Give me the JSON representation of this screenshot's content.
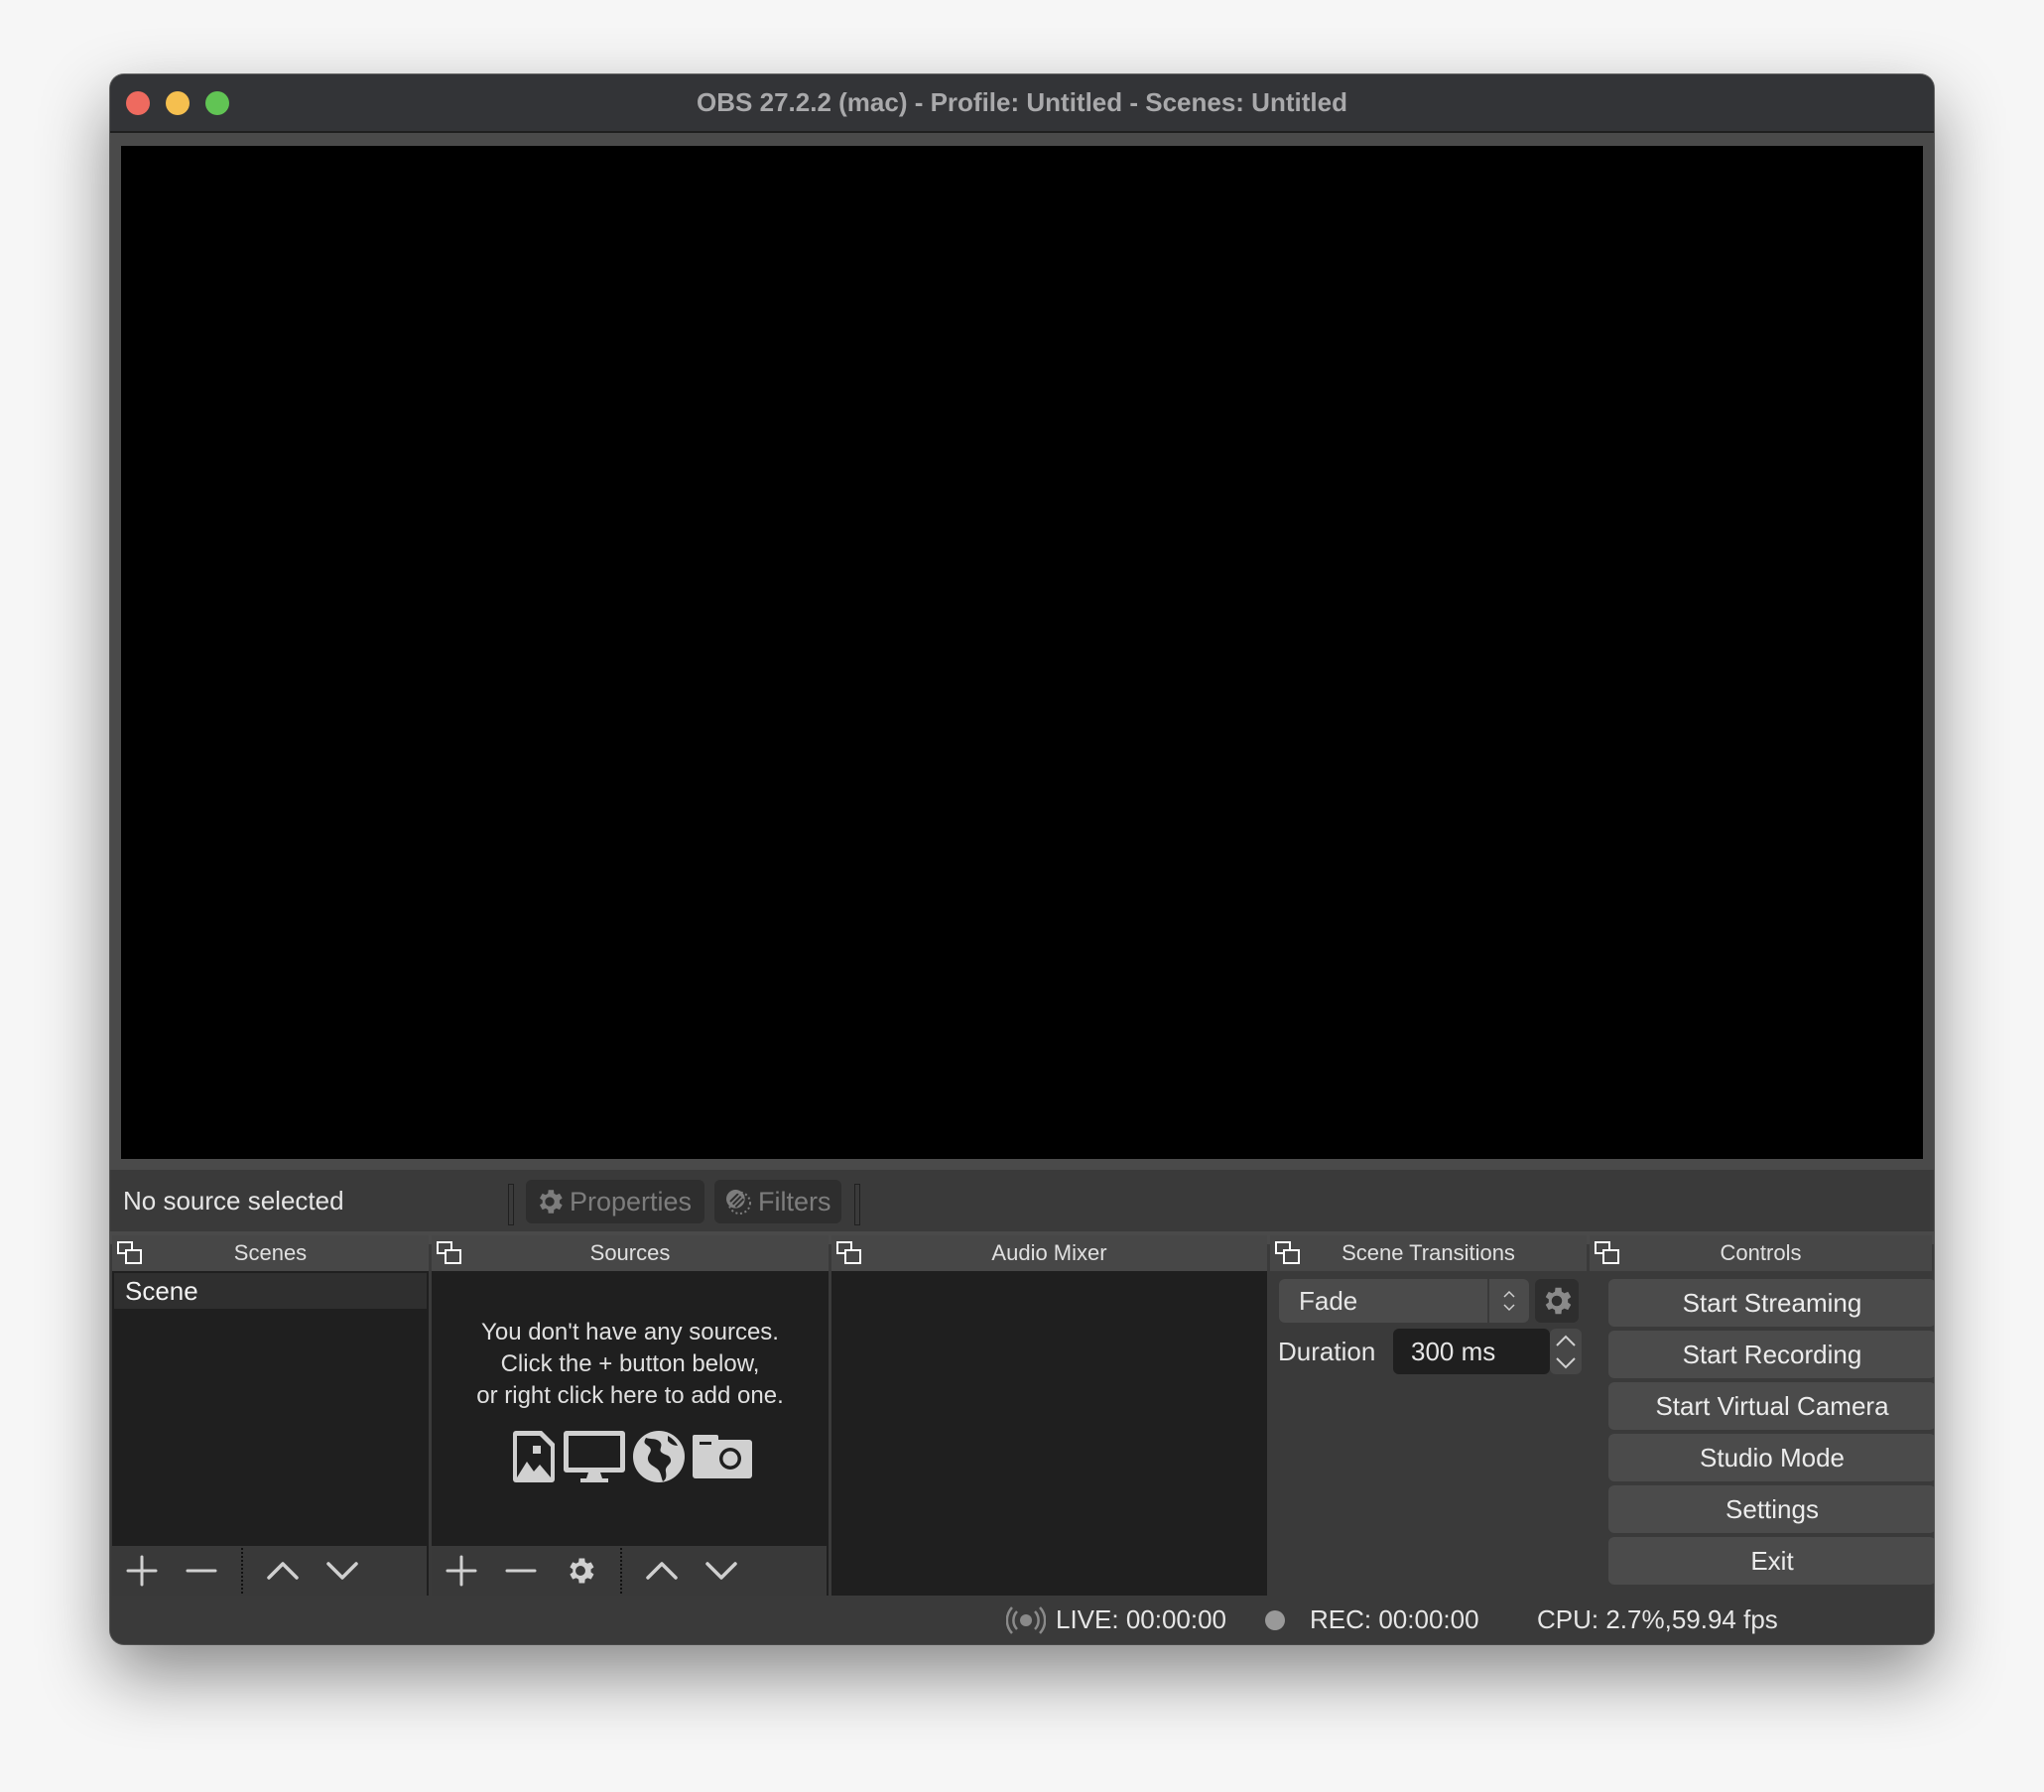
{
  "window": {
    "title": "OBS 27.2.2 (mac) - Profile: Untitled - Scenes: Untitled",
    "traffic_lights": {
      "close": "#ee6a5f",
      "minimize": "#f5bf4f",
      "maximize": "#61c454"
    }
  },
  "context_bar": {
    "selection_label": "No source selected",
    "properties_label": "Properties",
    "filters_label": "Filters"
  },
  "docks": {
    "scenes": {
      "title": "Scenes",
      "items": [
        {
          "label": "Scene",
          "selected": true
        }
      ]
    },
    "sources": {
      "title": "Sources",
      "empty_message": [
        "You don't have any sources.",
        "Click the + button below,",
        "or right click here to add one."
      ],
      "empty_icons": [
        "image-icon",
        "display-icon",
        "globe-icon",
        "camera-icon"
      ]
    },
    "audio_mixer": {
      "title": "Audio Mixer"
    },
    "scene_transitions": {
      "title": "Scene Transitions",
      "transition": "Fade",
      "duration_label": "Duration",
      "duration_value": "300 ms"
    },
    "controls": {
      "title": "Controls",
      "buttons": [
        "Start Streaming",
        "Start Recording",
        "Start Virtual Camera",
        "Studio Mode",
        "Settings",
        "Exit"
      ]
    }
  },
  "status_bar": {
    "live": "LIVE: 00:00:00",
    "rec": "REC: 00:00:00",
    "cpu": "CPU: 2.7%,59.94 fps"
  }
}
